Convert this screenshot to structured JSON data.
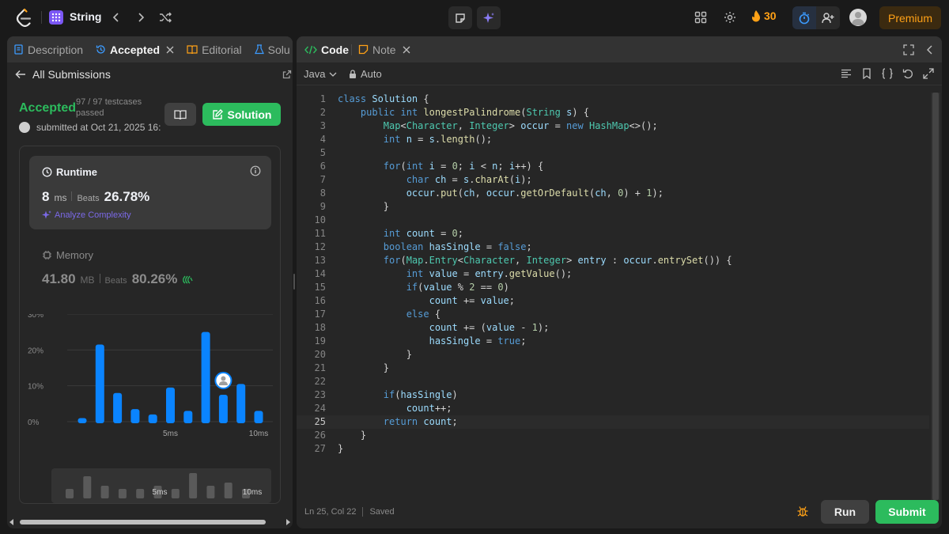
{
  "nav": {
    "problem_list_title": "String",
    "streak_count": "30",
    "premium_label": "Premium"
  },
  "left_panel": {
    "tabs": [
      {
        "label": "Description"
      },
      {
        "label": "Accepted"
      },
      {
        "label": "Editorial"
      },
      {
        "label": "Solu"
      }
    ],
    "back_label": "All Submissions",
    "status": "Accepted",
    "testcases": "97 / 97 testcases passed",
    "submitted_at": "submitted at Oct 21, 2025 16:",
    "solution_button": "Solution",
    "runtime": {
      "title": "Runtime",
      "value": "8",
      "unit": "ms",
      "beats_label": "Beats",
      "beats_value": "26.78%",
      "analyze_label": "Analyze Complexity"
    },
    "memory": {
      "title": "Memory",
      "value": "41.80",
      "unit": "MB",
      "beats_label": "Beats",
      "beats_value": "80.26%"
    }
  },
  "chart_data": {
    "type": "bar",
    "y_tick_labels": [
      "30%",
      "20%",
      "10%",
      "0%"
    ],
    "x_tick_labels": [
      "5ms",
      "10ms"
    ],
    "ylim": [
      0,
      30
    ],
    "values": [
      1,
      21.5,
      8,
      3.5,
      2,
      9.5,
      3,
      25,
      7.5,
      10.5,
      3
    ],
    "highlight_index": 8,
    "bar_color": "#0a84ff",
    "mini_values": [
      1,
      5,
      2,
      1,
      1,
      2,
      1,
      6,
      2,
      3,
      1
    ]
  },
  "editor": {
    "tabs": [
      {
        "label": "Code"
      },
      {
        "label": "Note"
      }
    ],
    "language": "Java",
    "mode": "Auto",
    "cursor_position": "Ln 25, Col 22",
    "save_status": "Saved",
    "run_label": "Run",
    "submit_label": "Submit",
    "current_line": 25,
    "lines": [
      "class Solution {",
      "    public int longestPalindrome(String s) {",
      "        Map<Character, Integer> occur = new HashMap<>();",
      "        int n = s.length();",
      "",
      "        for(int i = 0; i < n; i++) {",
      "            char ch = s.charAt(i);",
      "            occur.put(ch, occur.getOrDefault(ch, 0) + 1);",
      "        }",
      "",
      "        int count = 0;",
      "        boolean hasSingle = false;",
      "        for(Map.Entry<Character, Integer> entry : occur.entrySet()) {",
      "            int value = entry.getValue();",
      "            if(value % 2 == 0)",
      "                count += value;",
      "            else {",
      "                count += (value - 1);",
      "                hasSingle = true;",
      "            }",
      "        }",
      "",
      "        if(hasSingle)",
      "            count++;",
      "        return count;",
      "    }",
      "}"
    ]
  },
  "colors": {
    "accent_green": "#2cbb5d",
    "premium_orange": "#ffa116",
    "chart_blue": "#0a84ff",
    "ai_purple": "#7b69e8"
  }
}
